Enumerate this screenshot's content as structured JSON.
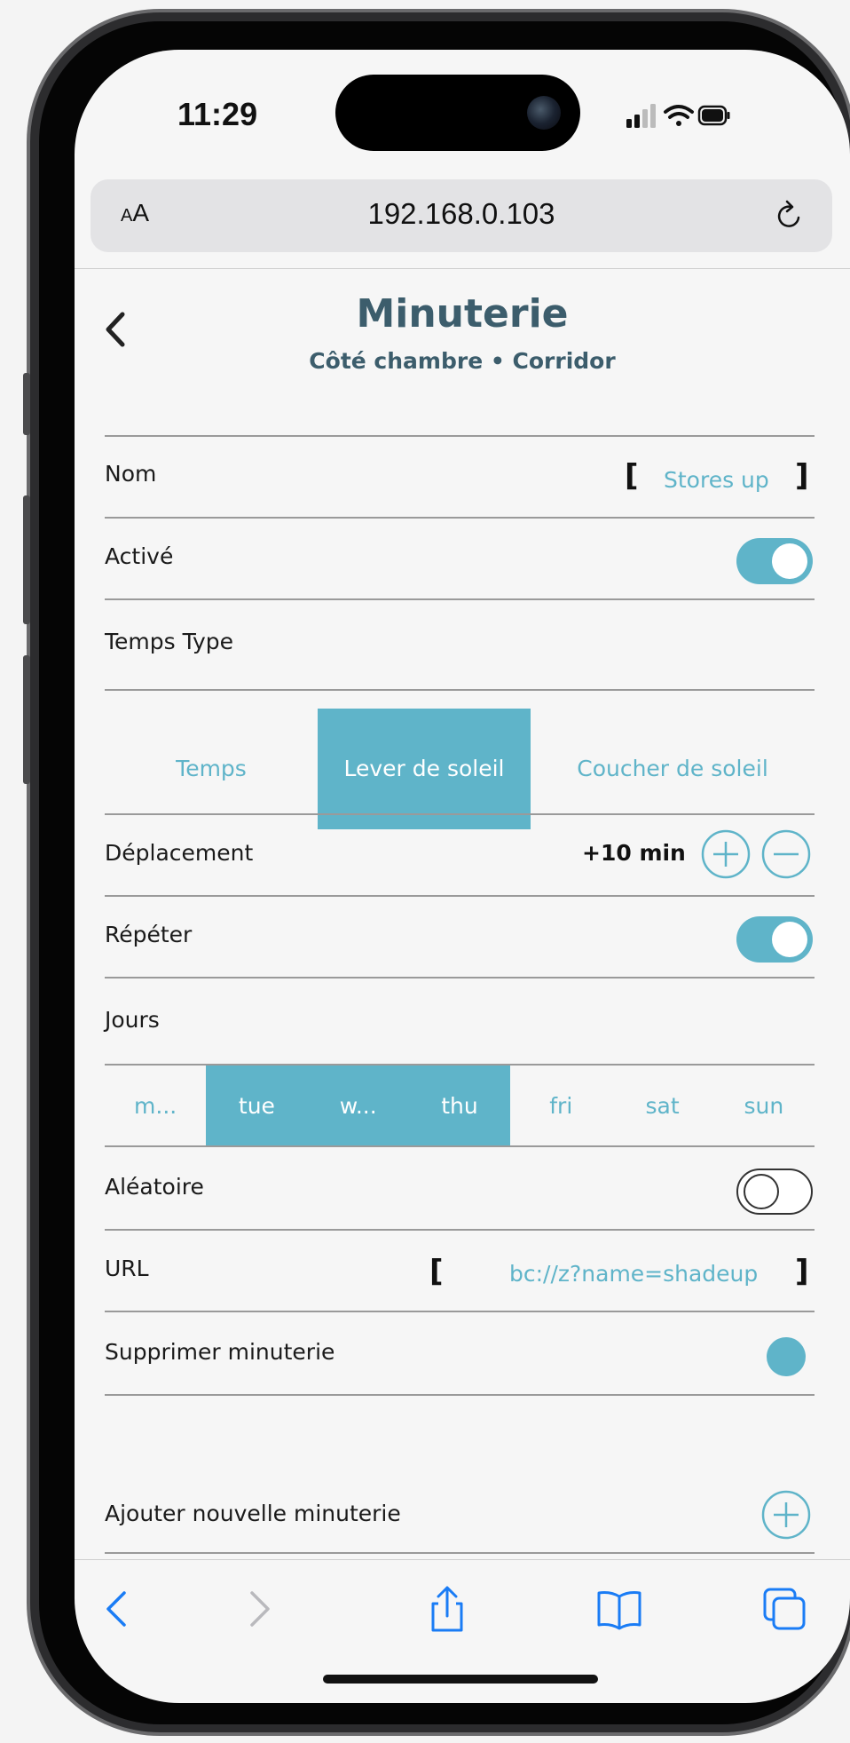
{
  "status_bar": {
    "time": "11:29"
  },
  "browser": {
    "aa_label_small": "A",
    "aa_label_large": "A",
    "url": "192.168.0.103"
  },
  "header": {
    "title": "Minuterie",
    "subtitle": "Côté chambre • Corridor"
  },
  "rows": {
    "nom": {
      "label": "Nom",
      "value": "Stores up"
    },
    "active": {
      "label": "Activé",
      "on": true
    },
    "temps_type": {
      "label": "Temps Type",
      "options": [
        "Temps",
        "Lever de soleil",
        "Coucher de soleil"
      ],
      "selected": "Lever de soleil"
    },
    "deplacement": {
      "label": "Déplacement",
      "value": "+10 min"
    },
    "repeter": {
      "label": "Répéter",
      "on": true
    },
    "jours": {
      "label": "Jours",
      "days": [
        "m...",
        "tue",
        "w...",
        "thu",
        "fri",
        "sat",
        "sun"
      ],
      "selected": [
        "tue",
        "w...",
        "thu"
      ]
    },
    "aleatoire": {
      "label": "Aléatoire",
      "on": false
    },
    "url": {
      "label": "URL",
      "value": "bc://z?name=shadeup"
    },
    "supprimer": {
      "label": "Supprimer minuterie"
    },
    "ajouter": {
      "label": "Ajouter nouvelle minuterie"
    }
  },
  "brackets": {
    "open": "[",
    "close": "]"
  },
  "colors": {
    "accent": "#5fb4c9",
    "title": "#3c5d6c",
    "ios_blue": "#1a7cf5"
  },
  "icons": [
    "back-chevron-icon",
    "reload-icon",
    "plus-circle-icon",
    "minus-circle-icon",
    "share-icon",
    "bookmarks-icon",
    "tabs-icon",
    "signal-icon",
    "wifi-icon",
    "battery-icon"
  ]
}
